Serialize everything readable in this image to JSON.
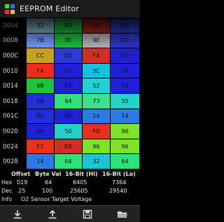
{
  "app": {
    "title": "EEPROM Editor"
  },
  "grid": {
    "rows": [
      {
        "addr": "0004",
        "cells": [
          {
            "v": "32",
            "c": "#8fd0df"
          },
          {
            "v": "4D",
            "c": "#25d04a"
          },
          {
            "v": "E8",
            "c": "#b22222"
          },
          {
            "v": "A3",
            "c": "#2c3fd1"
          }
        ]
      },
      {
        "addr": "0008",
        "cells": [
          {
            "v": "7B",
            "c": "#6f9aff"
          },
          {
            "v": "0E",
            "c": "#1fc43b"
          },
          {
            "v": "9E",
            "c": "#b6b6b6"
          },
          {
            "v": "DD",
            "c": "#2f34cf"
          }
        ]
      },
      {
        "addr": "000C",
        "cells": [
          {
            "v": "CC",
            "c": "#c5a224"
          },
          {
            "v": "D0",
            "c": "#2b3ad4"
          },
          {
            "v": "F4",
            "c": "#d03020"
          },
          {
            "v": "00",
            "c": "#2020cc"
          }
        ]
      },
      {
        "addr": "0010",
        "cells": [
          {
            "v": "F4",
            "c": "#ee2d1a"
          },
          {
            "v": "01",
            "c": "#2020d6"
          },
          {
            "v": "3C",
            "c": "#14c0e6"
          },
          {
            "v": "00",
            "c": "#2020d6"
          }
        ]
      },
      {
        "addr": "0014",
        "cells": [
          {
            "v": "6B",
            "c": "#20c43a"
          },
          {
            "v": "01",
            "c": "#2020d6"
          },
          {
            "v": "52",
            "c": "#1ed2d6"
          },
          {
            "v": "03",
            "c": "#2020d6"
          }
        ]
      },
      {
        "addr": "0018",
        "cells": [
          {
            "v": "06",
            "c": "#2030d8"
          },
          {
            "v": "64",
            "c": "#30e07a"
          },
          {
            "v": "73",
            "c": "#3ce090"
          },
          {
            "v": "55",
            "c": "#22d4c8"
          }
        ]
      },
      {
        "addr": "001C",
        "cells": [
          {
            "v": "0C",
            "c": "#2030d8"
          },
          {
            "v": "00",
            "c": "#2020d6"
          },
          {
            "v": "14",
            "c": "#2c7ae4"
          },
          {
            "v": "14",
            "c": "#2c7ae4"
          }
        ]
      },
      {
        "addr": "0020",
        "cells": [
          {
            "v": "00",
            "c": "#2020d6"
          },
          {
            "v": "50",
            "c": "#20d0c8"
          },
          {
            "v": "F0",
            "c": "#e83020"
          },
          {
            "v": "96",
            "c": "#7ce22a"
          }
        ]
      },
      {
        "addr": "0024",
        "cells": [
          {
            "v": "F7",
            "c": "#e8301a"
          },
          {
            "v": "E8",
            "c": "#d23020"
          },
          {
            "v": "96",
            "c": "#7ce22a"
          },
          {
            "v": "96",
            "c": "#7ce22a"
          }
        ]
      },
      {
        "addr": "0028",
        "cells": [
          {
            "v": "14",
            "c": "#2c7ae4"
          },
          {
            "v": "64",
            "c": "#30e07a"
          },
          {
            "v": "32",
            "c": "#20c4d8"
          },
          {
            "v": "64",
            "c": "#30e07a"
          }
        ]
      }
    ]
  },
  "info": {
    "headers": {
      "offset": "Offset",
      "byte": "Byte Val",
      "hi": "16-Bit (Hi)",
      "lo": "16-Bit (Lo)"
    },
    "hex": {
      "label": "Hex",
      "offset": "019",
      "byte": "64",
      "hi": "6405",
      "lo": "7364"
    },
    "dec": {
      "label": "Dec",
      "offset": "25",
      "byte": "100",
      "hi": "25605",
      "lo": "29540"
    },
    "description": {
      "label": "Info",
      "text": "O2 Sensor Target Voltage"
    }
  },
  "toolbar": {
    "items": [
      {
        "icon": "download-icon"
      },
      {
        "icon": "upload-icon"
      },
      {
        "icon": "save-icon"
      },
      {
        "icon": "folder-open-icon"
      }
    ]
  }
}
